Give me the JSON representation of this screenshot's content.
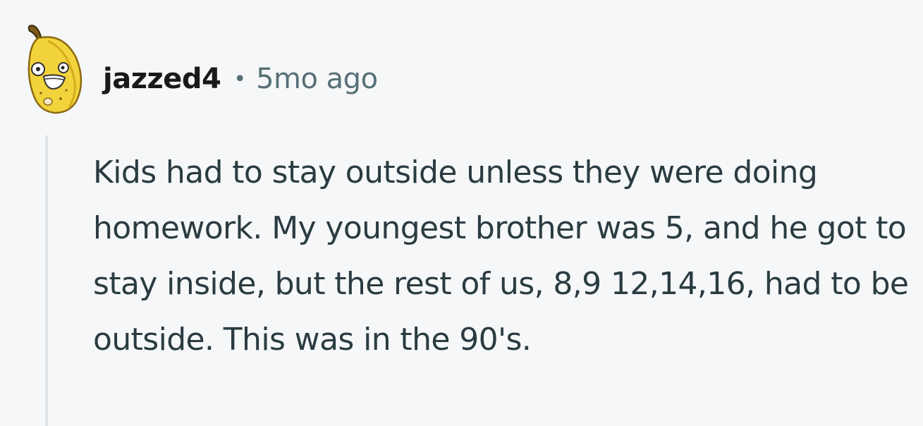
{
  "comment": {
    "author": "jazzed4",
    "separator": "•",
    "timestamp": "5mo ago",
    "avatar_icon": "banana-avatar-icon",
    "body": "Kids had to stay outside unless they were doing homework. My youngest brother was 5, and he got to stay inside, but the rest of us, 8,9 12,14,16, had to be outside. This was in the 90's."
  },
  "colors": {
    "background": "#f6f7f8",
    "author": "#1a1a1b",
    "meta": "#576f76",
    "body": "#2a3c42",
    "thread_line": "#dfe4e7",
    "avatar_yellow": "#f2d33b"
  }
}
